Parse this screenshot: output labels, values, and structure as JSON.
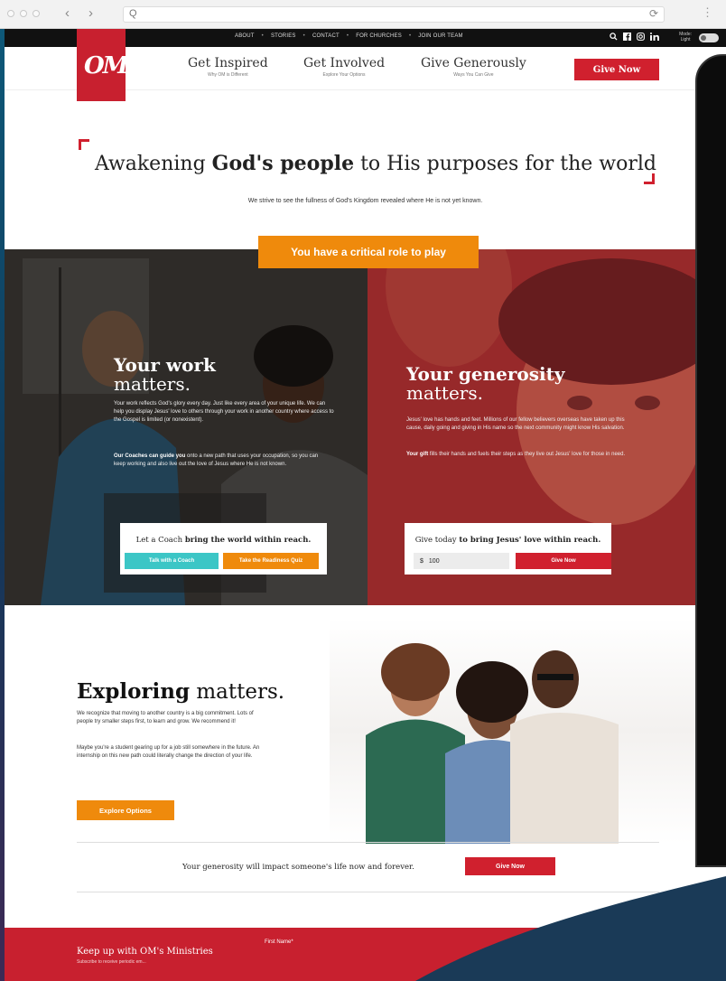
{
  "browser": {
    "search_glyph": "Q",
    "reload_glyph": "⟳",
    "menu_glyph": "⋮"
  },
  "topbar": {
    "links": [
      "ABOUT",
      "STORIES",
      "CONTACT",
      "FOR CHURCHES",
      "JOIN OUR TEAM"
    ],
    "separator": "•",
    "mode_label_1": "Mode:",
    "mode_label_2": "Light"
  },
  "logo": {
    "text": "OM"
  },
  "nav": {
    "items": [
      {
        "title": "Get Inspired",
        "sub": "Why OM is Different"
      },
      {
        "title": "Get Involved",
        "sub": "Explore Your Options"
      },
      {
        "title": "Give Generously",
        "sub": "Ways You Can Give"
      }
    ],
    "give_now": "Give Now"
  },
  "hero": {
    "title_a": "Awakening ",
    "title_b": "God's people",
    "title_c": " to His purposes for the world",
    "subtitle": "We strive to see the fullness of God's Kingdom revealed where He is not yet known."
  },
  "band": {
    "critical": "You have a critical role to play",
    "work": {
      "title_bold": "Your work",
      "title_light": "matters.",
      "p1": "Your work reflects God's glory every day. Just like every area of your unique life. We can help you display Jesus' love to others through your work in another country where access to the Gospel is limited (or nonexistent).",
      "p2_bold": "Our Coaches can guide you",
      "p2_rest": " onto a new path that uses your occupation, so you can keep working and also live out the love of Jesus where He is not known.",
      "cta_a": "Let a Coach ",
      "cta_b": "bring the world within reach.",
      "btn_coach": "Talk with a Coach",
      "btn_quiz": "Take the Readiness Quiz"
    },
    "generosity": {
      "title_bold": "Your generosity",
      "title_light": "matters.",
      "p1": "Jesus' love has hands and feet. Millions of our fellow believers overseas have taken up this cause, daily going and giving in His name so the next community might know His salvation.",
      "p2_bold": "Your gift",
      "p2_rest": " fills their hands and fuels their steps as they live out Jesus' love for those in need.",
      "cta_a": "Give today ",
      "cta_b": "to bring Jesus' love within reach.",
      "currency": "$",
      "amount": "100",
      "btn_give": "Give Now"
    }
  },
  "explore": {
    "title_bold": "Exploring",
    "title_light": " matters.",
    "p1": "We recognize that moving to another country is a big commitment. Lots of people try smaller steps first, to learn and grow. We recommend it!",
    "p2": "Maybe you're a student gearing up for a job still somewhere in the future. An internship on this new path could literally change the direction of your life.",
    "btn": "Explore Options"
  },
  "impact": {
    "text": "Your generosity will impact someone's life now and forever.",
    "btn": "Give Now"
  },
  "footer": {
    "keepup": "Keep up with OM's Ministries",
    "subscribe": "Subscribe to receive periodic em...",
    "first_name": "First Name*"
  },
  "colors": {
    "brand_red": "#d0202e",
    "accent_orange": "#ef8a0c",
    "teal": "#3cc6c6"
  }
}
